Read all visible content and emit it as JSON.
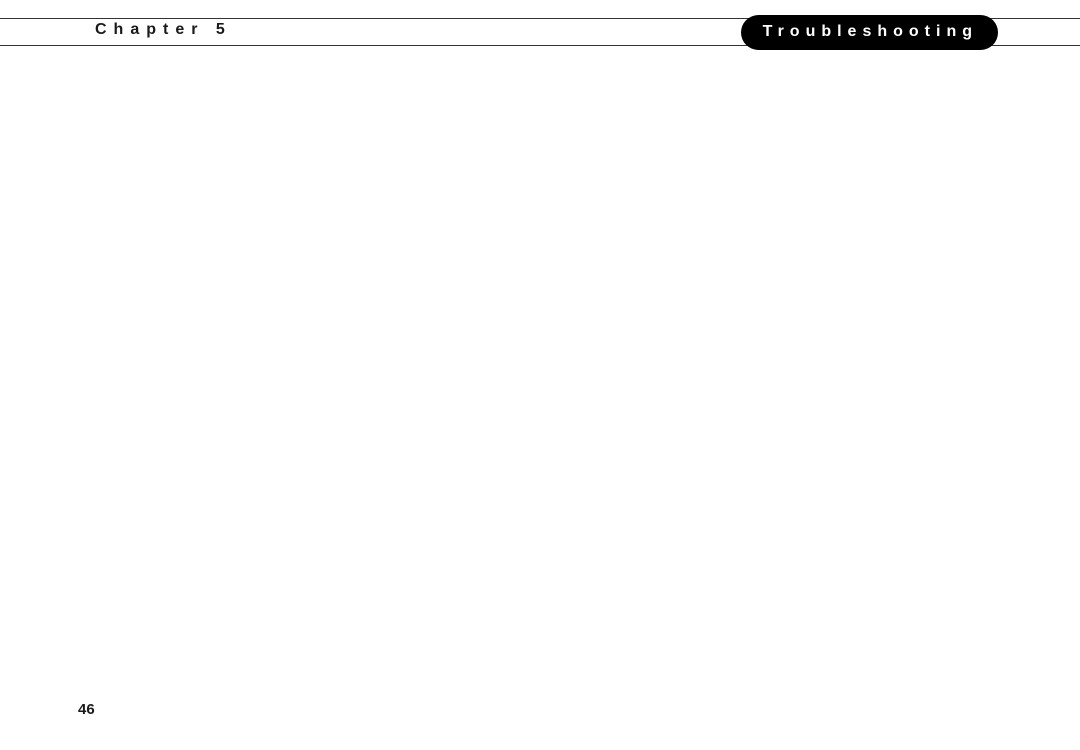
{
  "header": {
    "chapter_label": "Chapter 5",
    "title": "Troubleshooting"
  },
  "footer": {
    "page_number": "46"
  }
}
